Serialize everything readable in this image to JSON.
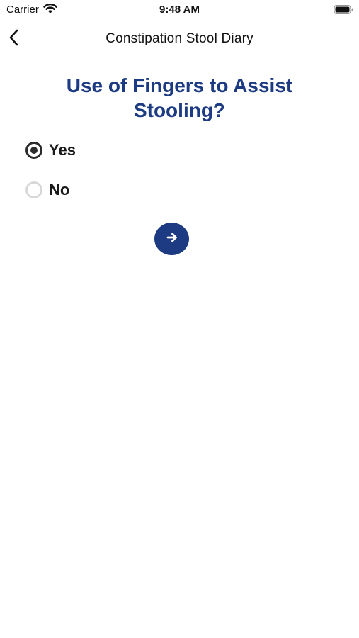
{
  "status_bar": {
    "carrier": "Carrier",
    "time": "9:48 AM",
    "wifi_icon": "wifi-icon",
    "battery_icon": "battery-icon"
  },
  "nav": {
    "title": "Constipation Stool Diary",
    "back_icon": "chevron-left-icon"
  },
  "question": {
    "text": "Use of Fingers to Assist Stooling?"
  },
  "options": [
    {
      "label": "Yes",
      "selected": true
    },
    {
      "label": "No",
      "selected": false
    }
  ],
  "next_button": {
    "icon": "arrow-right-icon"
  },
  "colors": {
    "accent": "#1d3b82",
    "radio_selected": "#2c2c2c",
    "radio_unselected": "#d8d8d8"
  }
}
